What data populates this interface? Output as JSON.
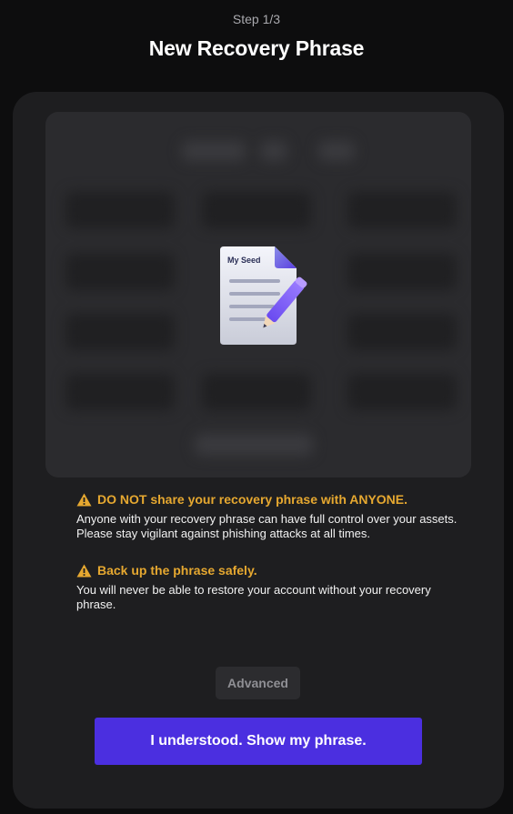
{
  "header": {
    "step": "Step 1/3",
    "title": "New Recovery Phrase"
  },
  "seed_card": {
    "icon_name": "seed-document-pencil-icon",
    "icon_label": "My Seed"
  },
  "warnings": [
    {
      "icon": "warning-triangle-icon",
      "title": "DO NOT share your recovery phrase with ANYONE.",
      "body": "Anyone with your recovery phrase can have full control over your assets. Please stay vigilant against phishing attacks at all times."
    },
    {
      "icon": "warning-triangle-icon",
      "title": "Back up the phrase safely.",
      "body": "You will never be able to restore your account without your recovery phrase."
    }
  ],
  "actions": {
    "advanced_label": "Advanced",
    "primary_label": "I understood. Show my phrase."
  },
  "colors": {
    "background": "#0d0d0e",
    "card": "#1e1e20",
    "warning": "#e6a830",
    "primary": "#4b2fe0"
  }
}
